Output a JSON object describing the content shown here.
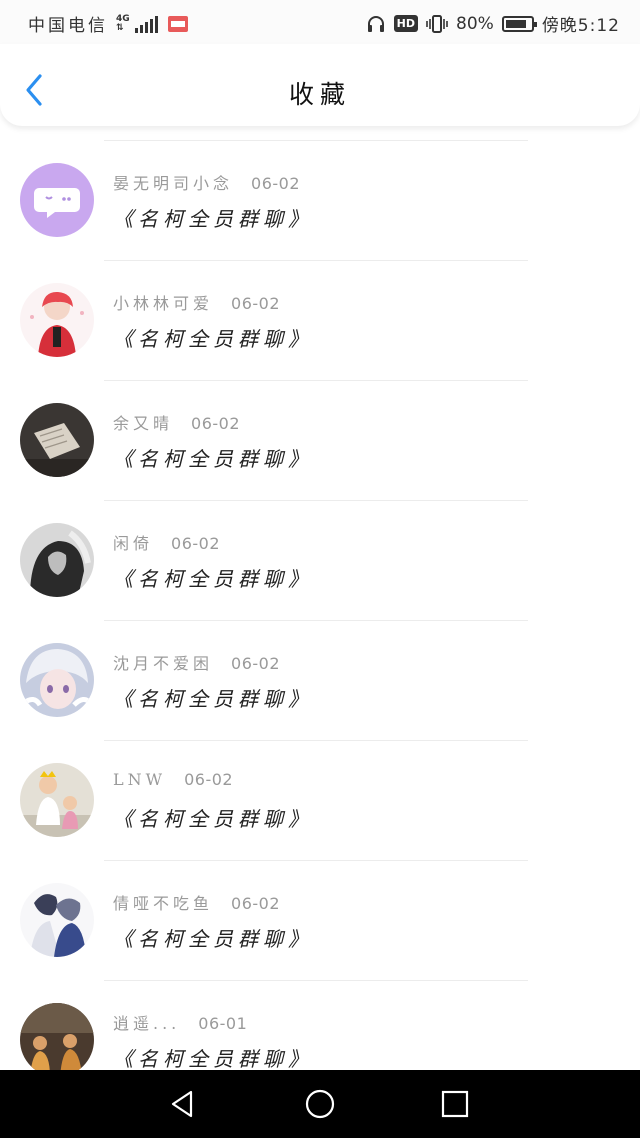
{
  "status_bar": {
    "carrier": "中国电信",
    "network": "4G",
    "battery": "80%",
    "time": "傍晚5:12"
  },
  "header": {
    "title": "收藏"
  },
  "favorites": [
    {
      "user": "晏无明司小念",
      "date": "06-02",
      "message": "《名柯全员群聊》",
      "avatar": "chat-bubble-icon"
    },
    {
      "user": "小林林可爱",
      "date": "06-02",
      "message": "《名柯全员群聊》",
      "avatar": "anime-red-hair"
    },
    {
      "user": "余又晴",
      "date": "06-02",
      "message": "《名柯全员群聊》",
      "avatar": "dark-book-photo"
    },
    {
      "user": "闲倚",
      "date": "06-02",
      "message": "《名柯全员群聊》",
      "avatar": "grayscale-portrait"
    },
    {
      "user": "沈月不爱困",
      "date": "06-02",
      "message": "《名柯全员群聊》",
      "avatar": "anime-white-hair"
    },
    {
      "user": "LNW",
      "date": "06-02",
      "message": "《名柯全员群聊》",
      "avatar": "kids-photo"
    },
    {
      "user": "倩哑不吃鱼",
      "date": "06-02",
      "message": "《名柯全员群聊》",
      "avatar": "anime-couple"
    },
    {
      "user": "逍遥...",
      "date": "06-01",
      "message": "《名柯全员群聊》",
      "avatar": "stage-photo"
    }
  ],
  "colors": {
    "accent": "#2b8ff0",
    "meta_text": "#9a9a9a",
    "nav_bar": "#000000"
  }
}
